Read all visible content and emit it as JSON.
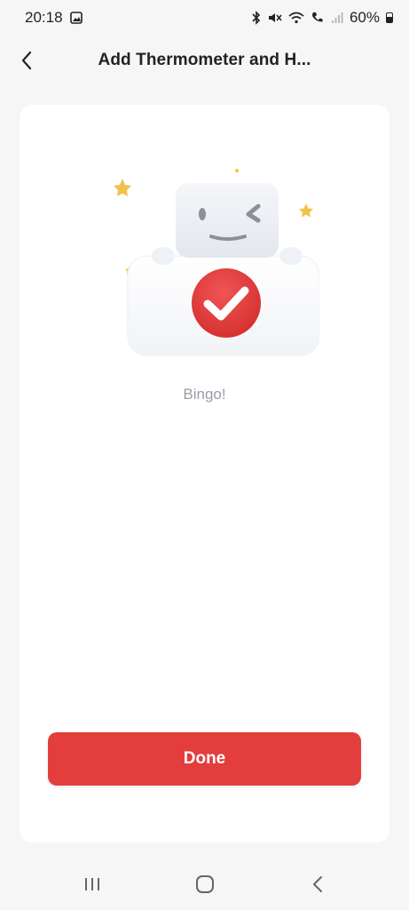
{
  "status_bar": {
    "time": "20:18",
    "battery": "60%",
    "icons": [
      "image-icon",
      "bluetooth-icon",
      "mute-icon",
      "wifi-icon",
      "call-icon",
      "signal-icon",
      "battery-icon"
    ]
  },
  "header": {
    "title": "Add Thermometer and H...",
    "back_icon": "chevron-left-icon"
  },
  "content": {
    "illustration": "robot-success-icon",
    "status_text": "Bingo!"
  },
  "actions": {
    "done_label": "Done"
  },
  "nav_bar": {
    "icons": [
      "recent-apps-icon",
      "home-icon",
      "back-icon"
    ]
  },
  "colors": {
    "accent": "#e33d3d",
    "background": "#f6f6f6",
    "card": "#ffffff",
    "muted_text": "#9a9ea6"
  }
}
